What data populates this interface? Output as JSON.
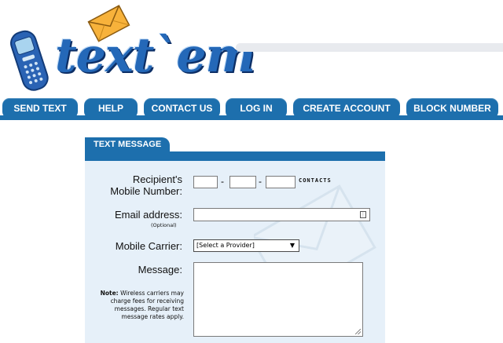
{
  "brand": {
    "name": "text`em"
  },
  "nav": [
    {
      "label": "SEND TEXT"
    },
    {
      "label": "HELP"
    },
    {
      "label": "CONTACT US"
    },
    {
      "label": "LOG IN"
    },
    {
      "label": "CREATE ACCOUNT"
    },
    {
      "label": "BLOCK NUMBER"
    }
  ],
  "form": {
    "tab_title": "TEXT MESSAGE",
    "recipient_label_line1": "Recipient's",
    "recipient_label_line2": "Mobile Number:",
    "phone_separator": "-",
    "contacts_link": "CONTACTS",
    "email_label": "Email address:",
    "email_optional": "(Optional)",
    "carrier_label": "Mobile Carrier:",
    "carrier_selected": "[Select a Provider]",
    "message_label": "Message:",
    "note_bold": "Note:",
    "note_text": "Wireless carriers may charge fees for receiving messages. Regular text message rates apply."
  },
  "colors": {
    "nav_blue": "#1d6fad",
    "panel_bg": "#e6f0f9",
    "brand_blue": "#2468b8",
    "envelope_orange": "#f5a623"
  },
  "icons": [
    "phone-icon",
    "envelope-icon",
    "email-field-icon",
    "dropdown-arrow-icon",
    "resize-handle-icon"
  ]
}
